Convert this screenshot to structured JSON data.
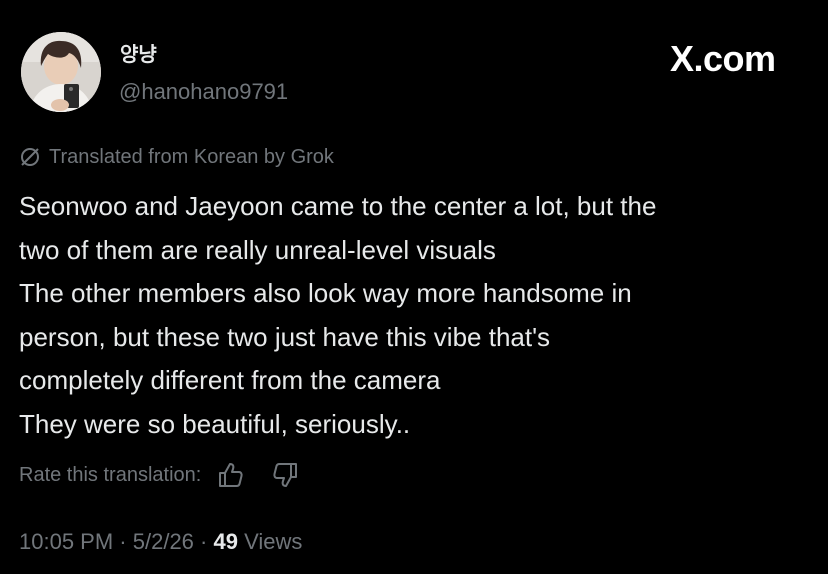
{
  "author": {
    "display_name": "양냥",
    "handle": "@hanohano9791",
    "avatar_icon": "profile-photo"
  },
  "brand": {
    "label": "X.com"
  },
  "translation": {
    "notice": "Translated from Korean by Grok",
    "icon": "grok-icon"
  },
  "post": {
    "lines": [
      "Seonwoo and Jaeyoon came to the center a lot, but the",
      "two of them are really unreal-level visuals",
      "The other members also look way more handsome in",
      "person, but these two just have this vibe that's",
      "completely different from the camera",
      "They were so beautiful, seriously.."
    ]
  },
  "rate": {
    "label": "Rate this translation:",
    "up_icon": "thumbs-up-icon",
    "down_icon": "thumbs-down-icon"
  },
  "meta": {
    "time": "10:05 PM",
    "separator": "·",
    "date": "5/2/26",
    "views_count": "49",
    "views_label": "Views"
  },
  "colors": {
    "background": "#000000",
    "primary_text": "#e7e9ea",
    "secondary_text": "#71767b"
  }
}
